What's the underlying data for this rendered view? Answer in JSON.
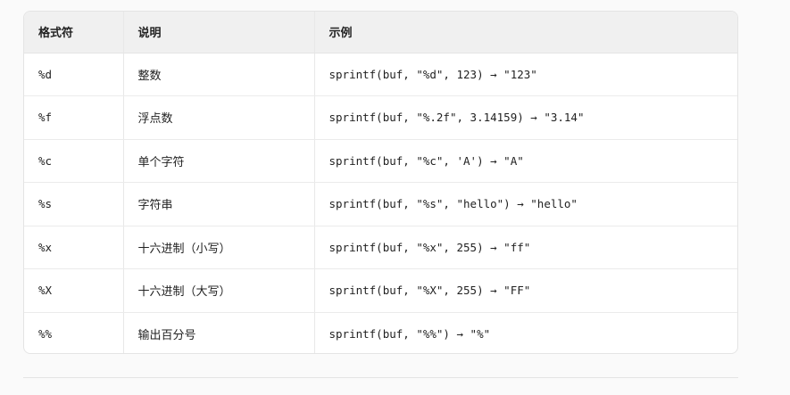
{
  "table": {
    "headers": [
      "格式符",
      "说明",
      "示例"
    ],
    "rows": [
      {
        "spec": "%d",
        "desc": "整数",
        "example": "sprintf(buf, \"%d\", 123) → \"123\""
      },
      {
        "spec": "%f",
        "desc": "浮点数",
        "example": "sprintf(buf, \"%.2f\", 3.14159) → \"3.14\""
      },
      {
        "spec": "%c",
        "desc": "单个字符",
        "example": "sprintf(buf, \"%c\", 'A') → \"A\""
      },
      {
        "spec": "%s",
        "desc": "字符串",
        "example": "sprintf(buf, \"%s\", \"hello\") → \"hello\""
      },
      {
        "spec": "%x",
        "desc": "十六进制（小写）",
        "example": "sprintf(buf, \"%x\", 255) → \"ff\""
      },
      {
        "spec": "%X",
        "desc": "十六进制（大写）",
        "example": "sprintf(buf, \"%X\", 255) → \"FF\""
      },
      {
        "spec": "%%",
        "desc": "输出百分号",
        "example": "sprintf(buf, \"%%\") → \"%\""
      }
    ]
  }
}
